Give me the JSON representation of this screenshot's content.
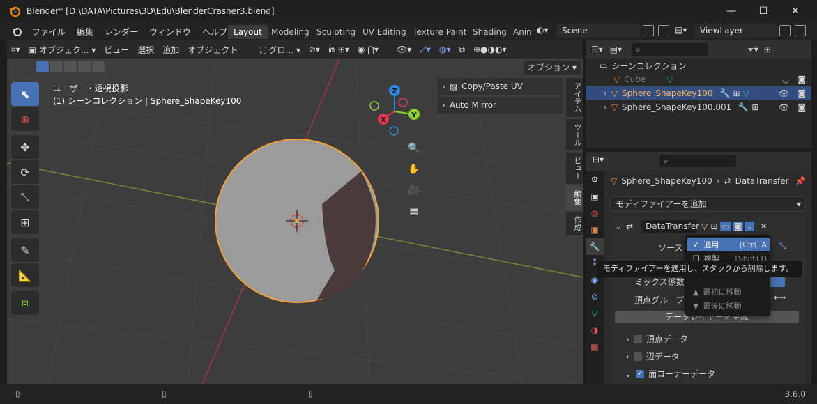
{
  "window": {
    "title": "Blender* [D:\\DATA\\Pictures\\3D\\Edu\\BlenderCrasher3.blend]"
  },
  "menu": [
    "ファイル",
    "編集",
    "レンダー",
    "ウィンドウ",
    "ヘルプ"
  ],
  "workspaces": [
    "Layout",
    "Modeling",
    "Sculpting",
    "UV Editing",
    "Texture Paint",
    "Shading",
    "Anin"
  ],
  "scene": "Scene",
  "view_layer": "ViewLayer",
  "viewport_header": {
    "mode": "オブジェク...",
    "menus": [
      "ビュー",
      "選択",
      "追加",
      "オブジェクト"
    ],
    "transform_orientation": "グロ...",
    "options": "オプション"
  },
  "viewport_info": {
    "view_name": "ユーザー・透視投影",
    "context": "(1) シーンコレクション | Sphere_ShapeKey100"
  },
  "n_panels": [
    "Copy/Paste UV",
    "Auto Mirror"
  ],
  "n_tabs": [
    "アイテム",
    "ツール",
    "ビュー",
    "編集",
    "作成"
  ],
  "gizmo": {
    "z": "Z",
    "y": "Y",
    "x": "X"
  },
  "outliner": {
    "collection": "シーンコレクション",
    "items": [
      {
        "name": "Cube"
      },
      {
        "name": "Sphere_ShapeKey100"
      },
      {
        "name": "Sphere_ShapeKey100.001"
      }
    ]
  },
  "properties": {
    "breadcrumb_object": "Sphere_ShapeKey100",
    "breadcrumb_modifier": "DataTransfer",
    "add_modifier": "モディファイアーを追加",
    "modifier_name": "DataTransfer",
    "source_label": "ソース",
    "mix_factor_label": "ミックス係数",
    "vertex_group_label": "頂点グループ",
    "generate_data_layers": "データレイヤーを生成",
    "sections": [
      {
        "label": "頂点データ",
        "checked": false
      },
      {
        "label": "辺データ",
        "checked": false
      },
      {
        "label": "面コーナーデータ",
        "checked": true
      }
    ]
  },
  "dropdown": {
    "items": [
      {
        "label": "適用",
        "shortcut": "[Ctrl] A"
      },
      {
        "label": "複製",
        "shortcut": "[Shift] D"
      },
      {
        "label": "最初に移動",
        "shortcut": ""
      },
      {
        "label": "最後に移動",
        "shortcut": ""
      }
    ]
  },
  "tooltip": "モディファイアーを適用し、スタックから削除します。",
  "status": {
    "version": "3.6.0"
  },
  "colors": {
    "accent": "#4772b3",
    "selection": "#ffa63d",
    "x_axis": "#e0394f",
    "y_axis": "#8bd02e",
    "z_axis": "#2f88e0"
  }
}
